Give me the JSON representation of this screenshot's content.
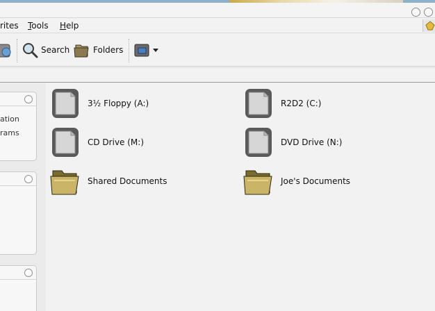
{
  "menu": {
    "items": [
      {
        "label": "rites"
      },
      {
        "label": "Tools",
        "underline": "T",
        "rest": "ools"
      },
      {
        "label": "Help",
        "underline": "H",
        "rest": "elp"
      }
    ]
  },
  "toolbar": {
    "search_label": "Search",
    "folders_label": "Folders"
  },
  "sidebar": {
    "panel1_lines": [
      "ation",
      "rams"
    ]
  },
  "items": [
    {
      "label": "3½ Floppy (A:)",
      "icon": "drive-icon"
    },
    {
      "label": "R2D2 (C:)",
      "icon": "drive-icon"
    },
    {
      "label": "CD Drive (M:)",
      "icon": "drive-icon"
    },
    {
      "label": "DVD Drive (N:)",
      "icon": "drive-icon"
    },
    {
      "label": "Shared Documents",
      "icon": "folder-icon"
    },
    {
      "label": "Joe's Documents",
      "icon": "folder-icon"
    }
  ],
  "colors": {
    "background": "#f2f2f2",
    "titlebar_strip": "#8fb1c7"
  }
}
